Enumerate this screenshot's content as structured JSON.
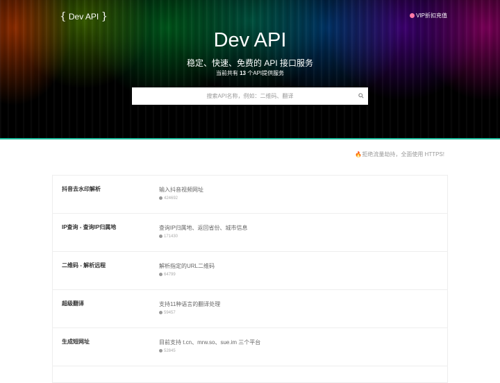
{
  "header": {
    "logo": "Dev API",
    "vip_label": "VIP折扣充值",
    "title": "Dev API",
    "subtitle": "稳定、快速、免费的 API 接口服务",
    "count_prefix": "当前共有",
    "count_value": "13",
    "count_suffix": "个API提供服务"
  },
  "search": {
    "placeholder": "搜索API名称，例如：二维码、翻译"
  },
  "notice": "🔥拒绝流量劫持，全面使用 HTTPS!",
  "apis": [
    {
      "name": "抖音去水印解析",
      "desc": "输入抖音视频网址",
      "views": "424692"
    },
    {
      "name": "IP查询 - 查询IP归属地",
      "desc": "查询IP归属地、返回省份、城市信息",
      "views": "171430"
    },
    {
      "name": "二维码 - 解析远程",
      "desc": "解析指定的URL二维码",
      "views": "64799"
    },
    {
      "name": "超级翻译",
      "desc": "支持11种语言的翻译处理",
      "views": "59457"
    },
    {
      "name": "生成短网址",
      "desc": "目前支持 t.cn、mrw.so、sue.im 三个平台",
      "views": "52845"
    }
  ],
  "colors": {
    "accent": "#1abc9c",
    "hero_bg": "#000000"
  }
}
